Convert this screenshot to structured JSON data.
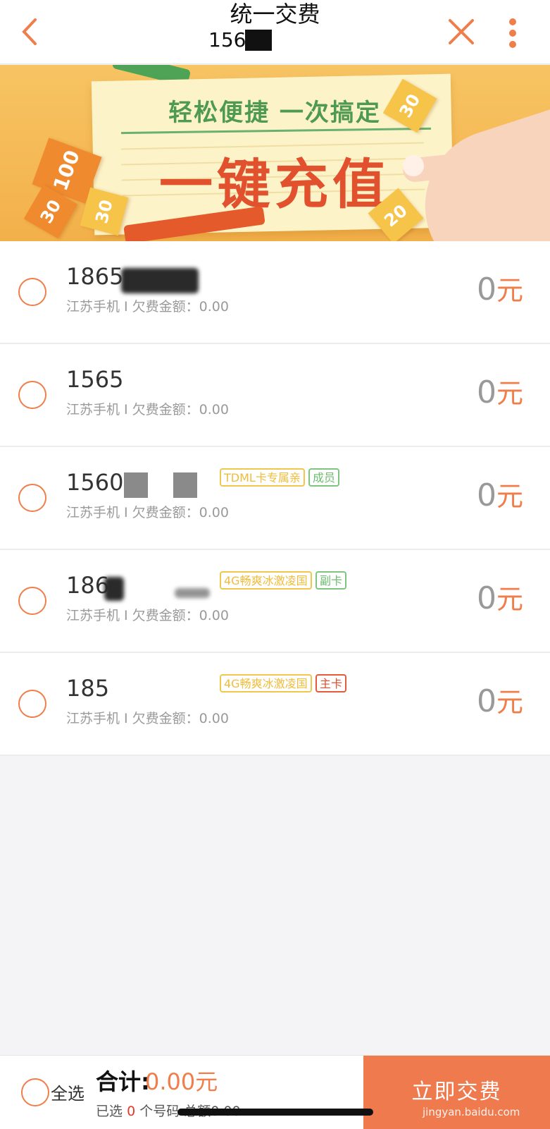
{
  "header": {
    "title": "统一交费",
    "subtitle": "1565"
  },
  "banner": {
    "tagline": "轻松便捷 一次搞定",
    "headline": "一键充值",
    "tickets": [
      "100",
      "30",
      "30",
      "30",
      "20"
    ]
  },
  "accounts": [
    {
      "phone": "1865",
      "desc": "江苏手机 I 欠费金额：0.00",
      "amount": "0",
      "unit": "元",
      "tags": []
    },
    {
      "phone": "1565",
      "desc": "江苏手机 I 欠费金额：0.00",
      "amount": "0",
      "unit": "元",
      "tags": []
    },
    {
      "phone": "1560",
      "desc": "江苏手机 I 欠费金额：0.00",
      "amount": "0",
      "unit": "元",
      "tags": [
        "TDML卡专属亲",
        "成员"
      ]
    },
    {
      "phone": "186",
      "desc": "江苏手机 I 欠费金额：0.00",
      "amount": "0",
      "unit": "元",
      "tags": [
        "4G畅爽冰激凌国",
        "副卡"
      ]
    },
    {
      "phone": "185",
      "desc": "江苏手机 I 欠费金额：0.00",
      "amount": "0",
      "unit": "元",
      "tags": [
        "4G畅爽冰激凌国",
        "主卡"
      ]
    }
  ],
  "footer": {
    "select_all": "全选",
    "total_label": "合计:",
    "total_amount": "0.00元",
    "selected_prefix": "已选",
    "selected_count": "0",
    "selected_suffix": "个号码 总额0.00",
    "pay_button": "立即交费"
  },
  "watermark": "jingyan.baidu.com",
  "colors": {
    "accent": "#ef7e4b",
    "tag_yellow": "#f0bc3a",
    "tag_green": "#6cbd6e",
    "tag_red": "#e34b2e"
  },
  "icons": [
    "back-arrow-icon",
    "close-icon",
    "more-vertical-icon",
    "radio-circle-icon"
  ]
}
